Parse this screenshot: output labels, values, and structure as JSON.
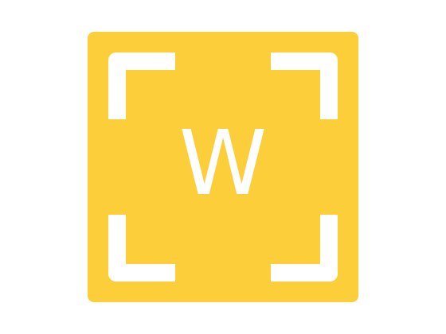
{
  "app_icon": {
    "letter": "W",
    "background_color": "#fcce3a",
    "foreground_color": "#ffffff",
    "decoration": "viewfinder-corner-brackets"
  }
}
